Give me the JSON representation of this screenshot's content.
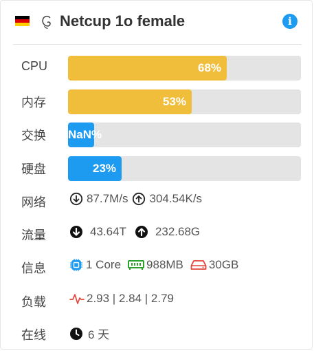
{
  "header": {
    "title": "Netcup 1o female",
    "flag_colors": [
      "#000000",
      "#dd0000",
      "#ffce00"
    ],
    "distro_icon": "debian-icon",
    "info_icon": "info-icon"
  },
  "rows": {
    "cpu": {
      "label": "CPU",
      "value_text": "68%",
      "percent": 68,
      "color": "#f0be3a"
    },
    "mem": {
      "label": "内存",
      "value_text": "53%",
      "percent": 53,
      "color": "#f0be3a"
    },
    "swap": {
      "label": "交换",
      "value_text": "NaN%",
      "percent": 0,
      "color": "#1c9bf0"
    },
    "disk": {
      "label": "硬盘",
      "value_text": "23%",
      "percent": 23,
      "color": "#1c9bf0"
    },
    "network": {
      "label": "网络",
      "down": "87.7M/s",
      "up": "304.54K/s"
    },
    "traffic": {
      "label": "流量",
      "down": "43.64T",
      "up": "232.68G"
    },
    "info": {
      "label": "信息",
      "cpu": "1 Core",
      "ram": "988MB",
      "disk": "30GB"
    },
    "load": {
      "label": "负载",
      "value": "2.93 | 2.84 | 2.79"
    },
    "uptime": {
      "label": "在线",
      "value": "6 天"
    }
  },
  "colors": {
    "accent_yellow": "#f0be3a",
    "accent_blue": "#1c9bf0",
    "track": "#e4e4e4",
    "ram_icon": "#2ea02e",
    "disk_icon": "#e0443a",
    "load_icon": "#e0443a"
  }
}
